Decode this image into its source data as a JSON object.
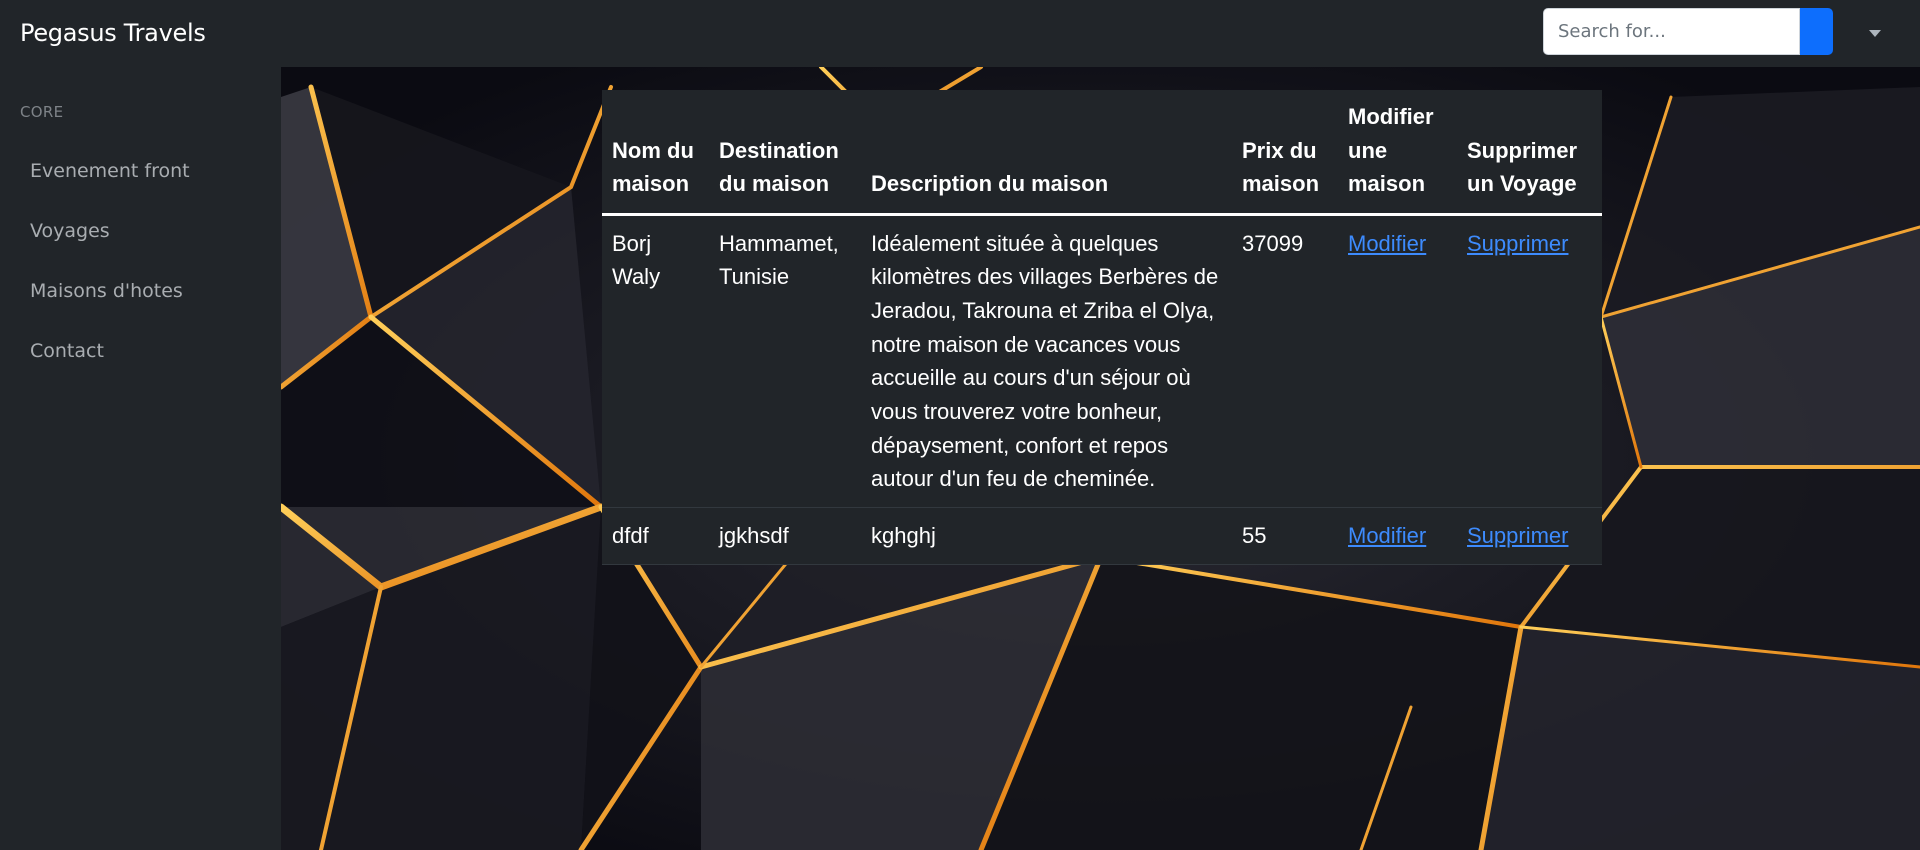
{
  "navbar": {
    "brand": "Pegasus Travels",
    "search_placeholder": "Search for..."
  },
  "sidebar": {
    "heading": "CORE",
    "items": [
      {
        "label": "Evenement front"
      },
      {
        "label": "Voyages"
      },
      {
        "label": "Maisons d'hotes"
      },
      {
        "label": "Contact"
      }
    ]
  },
  "table": {
    "headers": [
      "Nom du maison",
      "Destination du maison",
      "Description du maison",
      "Prix du maison",
      "Modifier une maison",
      "Supprimer un Voyage"
    ],
    "rows": [
      {
        "nom": "Borj Waly",
        "destination": "Hammamet, Tunisie",
        "description": "Idéalement située à quelques kilomètres des villages Berbères de Jeradou, Takrouna et Zriba el Olya, notre maison de vacances vous accueille au cours d'un séjour où vous trouverez votre bonheur, dépaysement, confort et repos autour d'un feu de cheminée.",
        "prix": "37099",
        "modifier": "Modifier",
        "supprimer": "Supprimer"
      },
      {
        "nom": "dfdf",
        "destination": "jgkhsdf",
        "description": "kghghj",
        "prix": "55",
        "modifier": "Modifier",
        "supprimer": "Supprimer"
      }
    ]
  },
  "colors": {
    "navbar_bg": "#212529",
    "accent": "#0d6efd",
    "link": "#3d8bfd",
    "bg_glow": "#f7a21b"
  }
}
